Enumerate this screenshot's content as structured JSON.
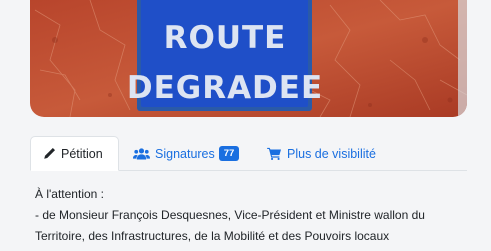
{
  "hero": {
    "sign_line1": "ROUTE",
    "sign_line2": "DEGRADEE"
  },
  "tabs": [
    {
      "label": "Pétition",
      "icon": "pencil-icon",
      "active": true
    },
    {
      "label": "Signatures",
      "icon": "users-icon",
      "badge": "77",
      "active": false
    },
    {
      "label": "Plus de visibilité",
      "icon": "cart-icon",
      "active": false
    }
  ],
  "content": {
    "lines": [
      "À l'attention :",
      "- de Monsieur François Desquesnes, Vice-Président et Ministre wallon du",
      "Territoire, des Infrastructures, de la Mobilité et des Pouvoirs locaux"
    ]
  },
  "colors": {
    "link": "#1a6fe0",
    "sign_blue": "#1f4fc8",
    "sign_frame": "#c8462a"
  }
}
